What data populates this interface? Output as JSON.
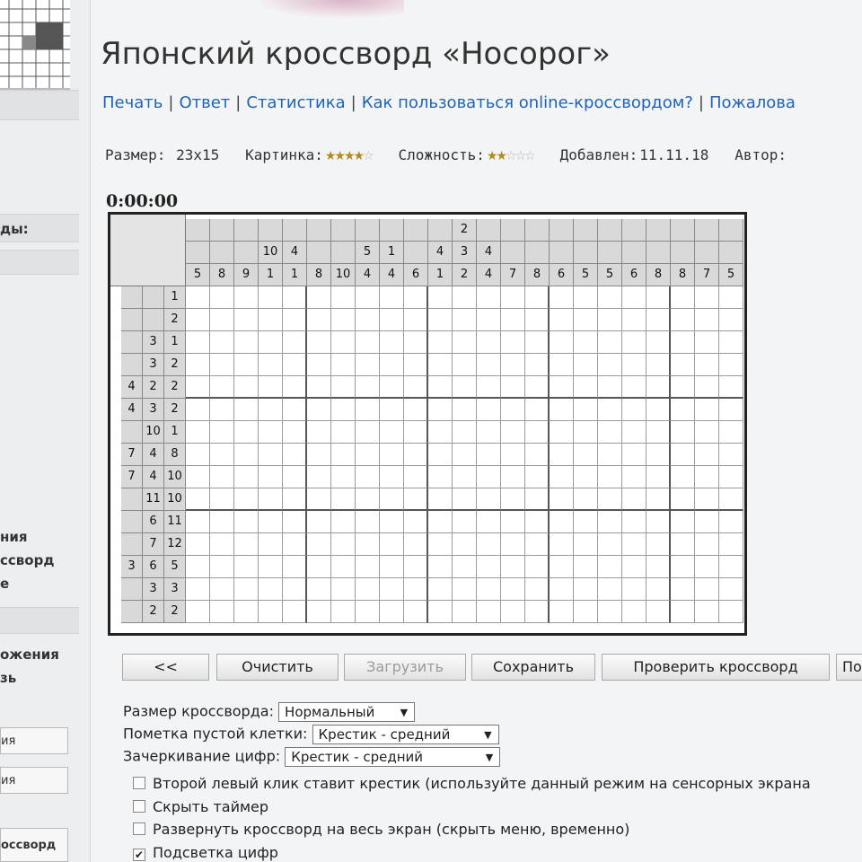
{
  "page": {
    "title": "Японский кроссворд «Носорог»",
    "timer": "0:00:00"
  },
  "nav": {
    "links": [
      "Печать",
      "Ответ",
      "Статистика",
      "Как пользоваться online-кроссвордом?",
      "Пожалова"
    ]
  },
  "info": {
    "size_label": "Размер:",
    "size_value": "23x15",
    "picture_label": "Картинка:",
    "picture_rating": 4,
    "difficulty_label": "Сложность:",
    "difficulty_rating": 2,
    "stars_total": 5,
    "added_label": "Добавлен:",
    "added_value": "11.11.18",
    "author_label": "Автор:",
    "star_color": "#b48a1a"
  },
  "sidebar": {
    "texts": [
      "ды:",
      "ния",
      "ссворд",
      "е",
      "ожения",
      "зь",
      "ия",
      "ия",
      "оссворд"
    ]
  },
  "puzzle": {
    "columns": 23,
    "rows": 15,
    "column_clues": [
      [
        "5"
      ],
      [
        "8"
      ],
      [
        "9"
      ],
      [
        "10",
        "1"
      ],
      [
        "4",
        "1"
      ],
      [
        "8"
      ],
      [
        "10"
      ],
      [
        "5",
        "4"
      ],
      [
        "1",
        "4"
      ],
      [
        "6"
      ],
      [
        "4",
        "1"
      ],
      [
        "2",
        "3",
        "2"
      ],
      [
        "4",
        "4"
      ],
      [
        "7"
      ],
      [
        "8"
      ],
      [
        "6"
      ],
      [
        "5"
      ],
      [
        "5"
      ],
      [
        "6"
      ],
      [
        "8"
      ],
      [
        "8"
      ],
      [
        "7"
      ],
      [
        "5"
      ]
    ],
    "row_clues": [
      [
        "1"
      ],
      [
        "2"
      ],
      [
        "3",
        "1"
      ],
      [
        "3",
        "2"
      ],
      [
        "4",
        "2",
        "2"
      ],
      [
        "4",
        "3",
        "2"
      ],
      [
        "10",
        "1"
      ],
      [
        "7",
        "4",
        "8"
      ],
      [
        "7",
        "4",
        "10"
      ],
      [
        "11",
        "10"
      ],
      [
        "6",
        "11"
      ],
      [
        "7",
        "12"
      ],
      [
        "3",
        "6",
        "5"
      ],
      [
        "3",
        "3"
      ],
      [
        "2",
        "2"
      ]
    ]
  },
  "buttons": {
    "back": "<<",
    "clear": "Очистить",
    "load": "Загрузить",
    "save": "Сохранить",
    "check": "Проверить кроссворд",
    "next": "По"
  },
  "options": {
    "size_label": "Размер кроссворда:",
    "size_value": "Нормальный",
    "empty_mark_label": "Пометка пустой клетки:",
    "empty_mark_value": "Крестик - средний",
    "strike_label": "Зачеркивание цифр:",
    "strike_value": "Крестик - средний",
    "checkboxes": [
      {
        "label": "Второй левый клик ставит крестик (используйте данный режим на сенсорных экрана",
        "checked": false
      },
      {
        "label": "Скрыть таймер",
        "checked": false
      },
      {
        "label": "Развернуть кроссворд на весь экран (скрыть меню, временно)",
        "checked": false
      },
      {
        "label": "Подсветка цифр",
        "checked": true
      }
    ]
  }
}
